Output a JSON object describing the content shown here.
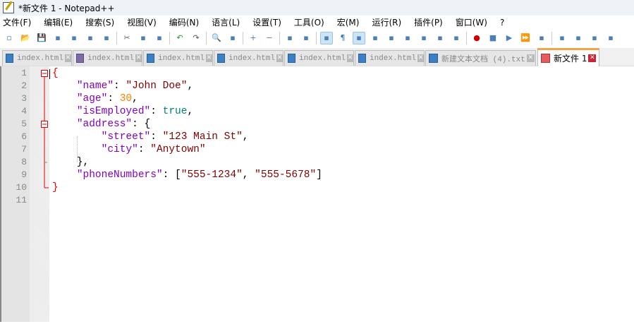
{
  "window": {
    "title": "*新文件 1 - Notepad++"
  },
  "menu": [
    "文件(F)",
    "编辑(E)",
    "搜索(S)",
    "视图(V)",
    "编码(N)",
    "语言(L)",
    "设置(T)",
    "工具(O)",
    "宏(M)",
    "运行(R)",
    "插件(P)",
    "窗口(W)",
    "?"
  ],
  "toolbar": [
    "new-file",
    "open",
    "save",
    "save-all",
    "close",
    "close-all",
    "print",
    "|",
    "cut",
    "copy",
    "paste",
    "|",
    "undo",
    "redo",
    "|",
    "find",
    "replace",
    "|",
    "zoom-in",
    "zoom-out",
    "|",
    "sync-v",
    "sync-h",
    "|",
    "word-wrap",
    "show-all-chars",
    "indent-guide",
    "udl",
    "doc-map",
    "doc-list",
    "function-list",
    "folder-workspace",
    "monitor",
    "|",
    "record-macro",
    "stop-macro",
    "play-macro",
    "run-macro-multiple",
    "save-macro",
    "|",
    "spell-check",
    "compare",
    "compare-clear",
    "collapse"
  ],
  "tabs": [
    {
      "label": "index.html",
      "icon": "blue"
    },
    {
      "label": "index.html",
      "icon": "purple"
    },
    {
      "label": "index.html",
      "icon": "blue"
    },
    {
      "label": "index.html",
      "icon": "blue"
    },
    {
      "label": "index.html",
      "icon": "blue"
    },
    {
      "label": "index.html",
      "icon": "blue"
    },
    {
      "label": "新建文本文档 (4).txt",
      "icon": "blue"
    },
    {
      "label": "新文件 1",
      "icon": "red",
      "active": true
    }
  ],
  "editor": {
    "line_numbers": [
      "1",
      "2",
      "3",
      "4",
      "5",
      "6",
      "7",
      "8",
      "9",
      "10",
      "11"
    ],
    "lines": [
      [
        [
          "br",
          "{"
        ]
      ],
      [
        [
          "p",
          "    "
        ],
        [
          "k",
          "\"name\""
        ],
        [
          "p",
          ": "
        ],
        [
          "s",
          "\"John Doe\""
        ],
        [
          "p",
          ","
        ]
      ],
      [
        [
          "p",
          "    "
        ],
        [
          "k",
          "\"age\""
        ],
        [
          "p",
          ": "
        ],
        [
          "n",
          "30"
        ],
        [
          "p",
          ","
        ]
      ],
      [
        [
          "p",
          "    "
        ],
        [
          "k",
          "\"isEmployed\""
        ],
        [
          "p",
          ": "
        ],
        [
          "b",
          "true"
        ],
        [
          "p",
          ","
        ]
      ],
      [
        [
          "p",
          "    "
        ],
        [
          "k",
          "\"address\""
        ],
        [
          "p",
          ": {"
        ]
      ],
      [
        [
          "p",
          "        "
        ],
        [
          "k",
          "\"street\""
        ],
        [
          "p",
          ": "
        ],
        [
          "s",
          "\"123 Main St\""
        ],
        [
          "p",
          ","
        ]
      ],
      [
        [
          "p",
          "        "
        ],
        [
          "k",
          "\"city\""
        ],
        [
          "p",
          ": "
        ],
        [
          "s",
          "\"Anytown\""
        ]
      ],
      [
        [
          "p",
          "    },"
        ]
      ],
      [
        [
          "p",
          "    "
        ],
        [
          "k",
          "\"phoneNumbers\""
        ],
        [
          "p",
          ": ["
        ],
        [
          "s",
          "\"555-1234\""
        ],
        [
          "p",
          ", "
        ],
        [
          "s",
          "\"555-5678\""
        ],
        [
          "p",
          "]"
        ]
      ],
      [
        [
          "br",
          "}"
        ]
      ],
      []
    ]
  }
}
